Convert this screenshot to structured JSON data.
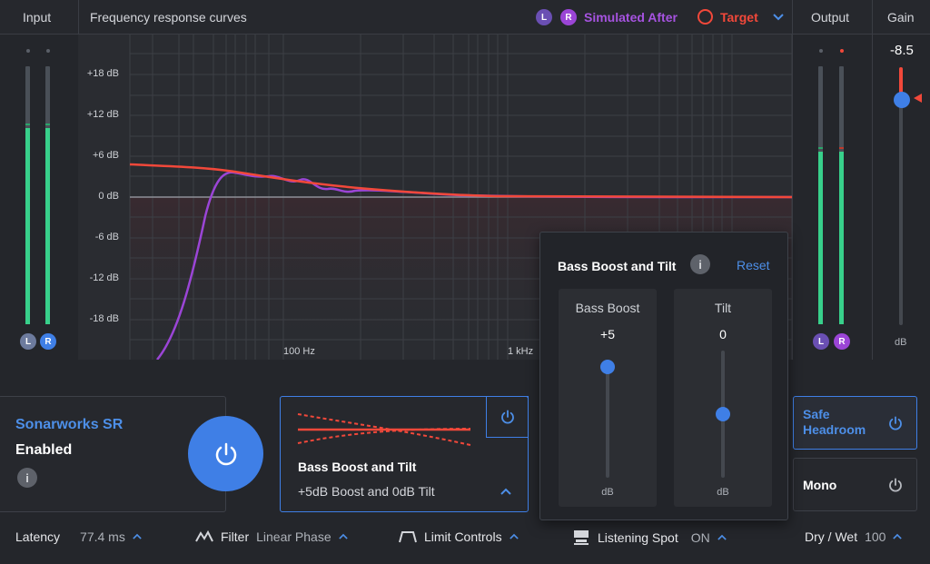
{
  "header": {
    "input_label": "Input",
    "graph_title": "Frequency response curves",
    "legend_l": "L",
    "legend_r": "R",
    "simulated_label": "Simulated After",
    "target_label": "Target",
    "output_label": "Output",
    "gain_label": "Gain"
  },
  "colors": {
    "accent": "#4d8fe8",
    "simulated": "#9b45d6",
    "target": "#f2483a",
    "meter": "#38d08b"
  },
  "input_meter": {
    "channels": [
      "L",
      "R"
    ],
    "levels": [
      0.76,
      0.76
    ]
  },
  "output_meter": {
    "channels": [
      "L",
      "R"
    ],
    "levels": [
      0.67,
      0.67
    ]
  },
  "gain": {
    "value": "-8.5",
    "unit": "dB",
    "level": 0.86
  },
  "graph": {
    "y_ticks": [
      "+18 dB",
      "+12 dB",
      "+6 dB",
      "0 dB",
      "-6 dB",
      "-12 dB",
      "-18 dB"
    ],
    "x_ticks": [
      "100 Hz",
      "1 kHz"
    ]
  },
  "product": {
    "name": "Sonarworks SR",
    "status": "Enabled"
  },
  "bass_card": {
    "title": "Bass Boost and Tilt",
    "summary": "+5dB Boost and 0dB Tilt"
  },
  "popup": {
    "title": "Bass Boost and Tilt",
    "reset_label": "Reset",
    "bass": {
      "label": "Bass Boost",
      "value": "+5",
      "unit": "dB",
      "level": 0.92
    },
    "tilt": {
      "label": "Tilt",
      "value": "0",
      "unit": "dB",
      "level": 0.5
    }
  },
  "right_buttons": {
    "safe_headroom": "Safe Headroom",
    "mono": "Mono"
  },
  "bottom": {
    "latency_label": "Latency",
    "latency_value": "77.4 ms",
    "filter_label": "Filter",
    "filter_value": "Linear Phase",
    "limit_label": "Limit Controls",
    "spot_label": "Listening Spot",
    "spot_value": "ON",
    "drywet_label": "Dry / Wet",
    "drywet_value": "100"
  }
}
